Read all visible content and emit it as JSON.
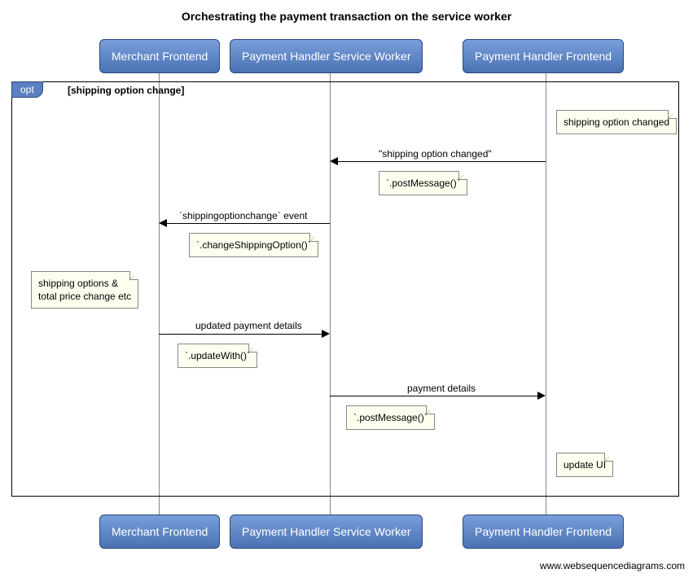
{
  "title": "Orchestrating the payment transaction on the service worker",
  "participants": {
    "p1": "Merchant Frontend",
    "p2": "Payment Handler Service Worker",
    "p3": "Payment Handler Frontend"
  },
  "opt": {
    "tag": "opt",
    "guard": "[shipping option change]"
  },
  "notes": {
    "n1": "shipping option changed",
    "n2": "`.postMessage()`",
    "n3": "`.changeShippingOption()`",
    "n4_line1": "shipping options &",
    "n4_line2": "total price change etc",
    "n5": "`.updateWith()`",
    "n6": "`.postMessage()`",
    "n7": "update UI"
  },
  "messages": {
    "m1": "\"shipping option changed\"",
    "m2": "`shippingoptionchange` event",
    "m3": "updated payment details",
    "m4": "payment details"
  },
  "attribution": "www.websequencediagrams.com",
  "chart_data": {
    "type": "sequence-diagram",
    "title": "Orchestrating the payment transaction on the service worker",
    "participants": [
      "Merchant Frontend",
      "Payment Handler Service Worker",
      "Payment Handler Frontend"
    ],
    "fragment": {
      "type": "opt",
      "guard": "shipping option change",
      "steps": [
        {
          "kind": "note",
          "participant": "Payment Handler Frontend",
          "position": "right",
          "text": "shipping option changed"
        },
        {
          "kind": "message",
          "from": "Payment Handler Frontend",
          "to": "Payment Handler Service Worker",
          "label": "\"shipping option changed\"",
          "note_below": "`.postMessage()`"
        },
        {
          "kind": "message",
          "from": "Payment Handler Service Worker",
          "to": "Merchant Frontend",
          "label": "`shippingoptionchange` event",
          "note_below": "`.changeShippingOption()`"
        },
        {
          "kind": "note",
          "participant": "Merchant Frontend",
          "position": "left",
          "text": "shipping options & total price change etc"
        },
        {
          "kind": "message",
          "from": "Merchant Frontend",
          "to": "Payment Handler Service Worker",
          "label": "updated payment details",
          "note_below": "`.updateWith()`"
        },
        {
          "kind": "message",
          "from": "Payment Handler Service Worker",
          "to": "Payment Handler Frontend",
          "label": "payment details",
          "note_below": "`.postMessage()`"
        },
        {
          "kind": "note",
          "participant": "Payment Handler Frontend",
          "position": "right",
          "text": "update UI"
        }
      ]
    }
  }
}
